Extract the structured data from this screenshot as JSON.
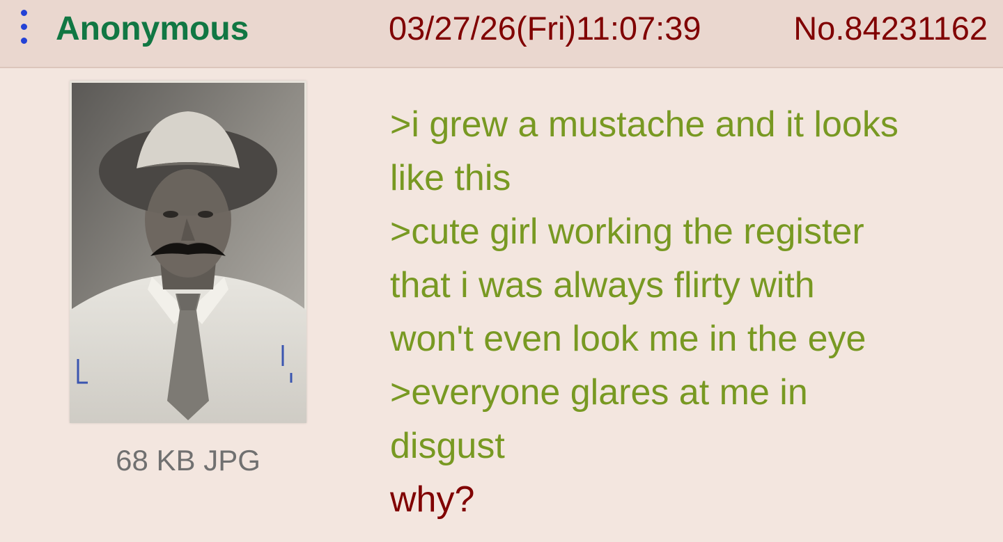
{
  "post": {
    "name": "Anonymous",
    "datetime": "03/27/26(Fri)11:07:39",
    "number": "No.84231162",
    "file": {
      "meta": "68 KB JPG"
    },
    "comment": {
      "lines": [
        ">i grew a mustache and it looks",
        "like this",
        ">cute girl working the register",
        "that i was always flirty with",
        "won't even look me in the eye",
        ">everyone glares at me in",
        "disgust",
        "why?"
      ]
    }
  },
  "icons": {
    "menu": "vertical-dots-icon"
  },
  "colors": {
    "background": "#f3e6df",
    "header": "#ead7cf",
    "name": "#117743",
    "meta": "#800000",
    "greentext": "#789922",
    "menu_dots": "#2442d6",
    "file_meta": "#707070"
  }
}
